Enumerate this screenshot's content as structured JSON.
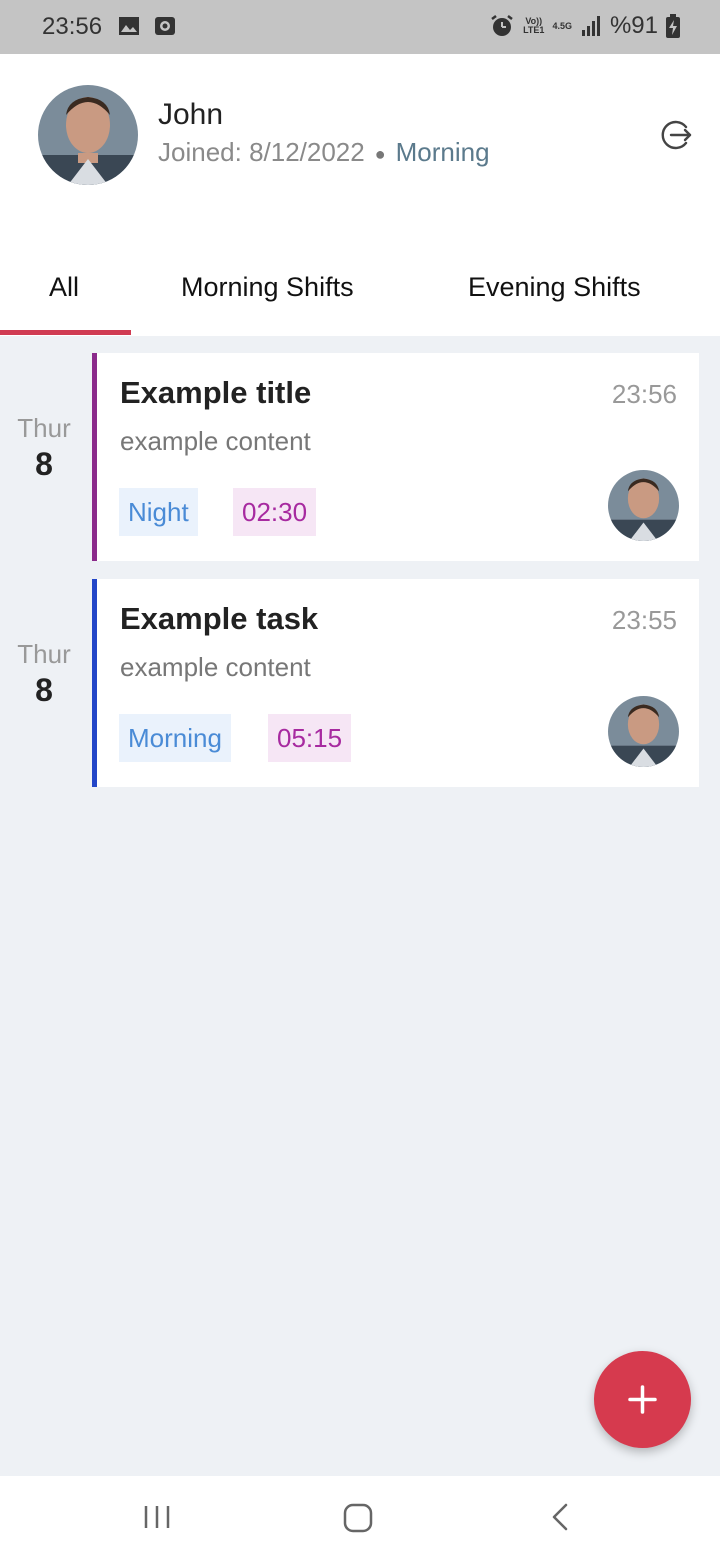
{
  "status_bar": {
    "time": "23:56",
    "network_top": "Vo))",
    "network_bottom": "LTE1",
    "net_type": "4.5G",
    "battery": "%91"
  },
  "header": {
    "user_name": "John",
    "joined": "Joined: 8/12/2022",
    "shift": "Morning"
  },
  "tabs": [
    {
      "label": "All",
      "active": true
    },
    {
      "label": "Morning Shifts",
      "active": false
    },
    {
      "label": "Evening Shifts",
      "active": false
    }
  ],
  "tasks": [
    {
      "day_name": "Thur",
      "day_num": "8",
      "title": "Example title",
      "time": "23:56",
      "content": "example content",
      "shift": "Night",
      "duration": "02:30",
      "accent": "#8b2a8b"
    },
    {
      "day_name": "Thur",
      "day_num": "8",
      "title": "Example task",
      "time": "23:55",
      "content": "example content",
      "shift": "Morning",
      "duration": "05:15",
      "accent": "#2346c8"
    }
  ],
  "colors": {
    "brand": "#d03b52",
    "fab": "#d63a4e",
    "chip_shift_text": "#4a8bd6",
    "chip_duration_text": "#a72aa0"
  },
  "icons": {
    "logout": "logout-icon",
    "fab": "plus-icon",
    "nav_recents": "recents-icon",
    "nav_home": "home-icon",
    "nav_back": "back-icon"
  }
}
